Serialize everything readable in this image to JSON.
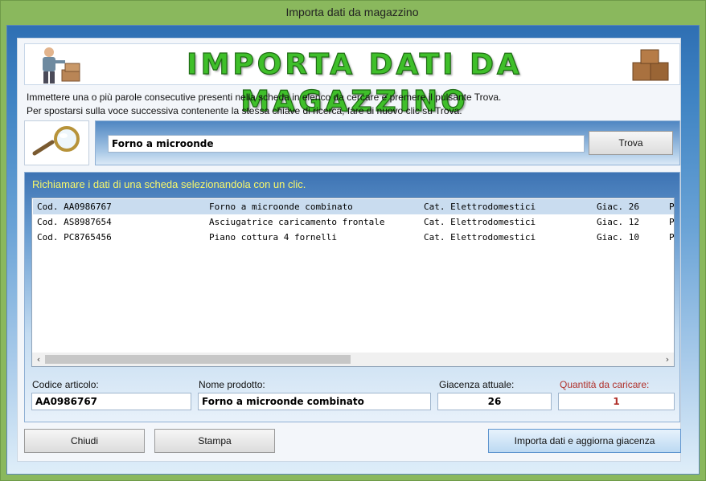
{
  "window": {
    "title": "Importa dati da magazzino"
  },
  "banner": {
    "title": "IMPORTA DATI DA MAGAZZINO"
  },
  "instructions": {
    "line1": "Immettere una o più parole consecutive presenti nella scheda in elenco da cercare e premere il pulsante Trova.",
    "line2": "Per spostarsi sulla voce successiva contenente la stessa chiave di ricerca, fare di nuovo clic su Trova."
  },
  "search": {
    "value": "Forno a microonde",
    "button_label": "Trova"
  },
  "list": {
    "hint": "Richiamare i dati di una scheda selezionandola con un clic.",
    "rows": [
      {
        "code": "Cod. AA0986767",
        "name": "Forno a microonde combinato",
        "category": "Cat. Elettrodomestici",
        "stock": "Giac. 26",
        "extra": "P",
        "selected": true
      },
      {
        "code": "Cod. AS8987654",
        "name": "Asciugatrice caricamento frontale",
        "category": "Cat. Elettrodomestici",
        "stock": "Giac. 12",
        "extra": "P",
        "selected": false
      },
      {
        "code": "Cod. PC8765456",
        "name": "Piano cottura 4 fornelli",
        "category": "Cat. Elettrodomestici",
        "stock": "Giac. 10",
        "extra": "P",
        "selected": false
      }
    ]
  },
  "fields": {
    "code_label": "Codice articolo:",
    "code_value": "AA0986767",
    "name_label": "Nome prodotto:",
    "name_value": "Forno a microonde combinato",
    "stock_label": "Giacenza attuale:",
    "stock_value": "26",
    "qty_label": "Quantità da caricare:",
    "qty_value": "1"
  },
  "buttons": {
    "close": "Chiudi",
    "print": "Stampa",
    "import": "Importa dati e aggiorna giacenza"
  },
  "colors": {
    "accent_green": "#3fbf2a",
    "hint_yellow": "#f7f76a",
    "qty_red": "#b0302a",
    "selection": "#c9dcef"
  }
}
